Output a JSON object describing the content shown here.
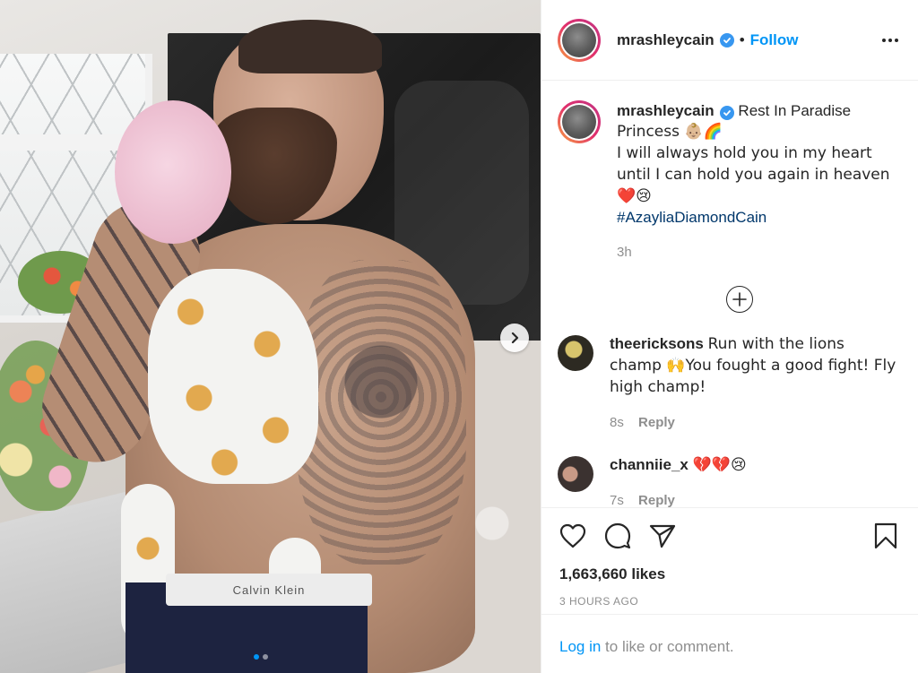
{
  "post": {
    "username": "mrashleycain",
    "follow_label": "Follow",
    "bullet": "•",
    "caption": {
      "line1": "Rest In Paradise",
      "line2": "Princess 👶🏼🌈",
      "line3": "I will always hold you in my heart until I can hold you again in heaven ❤️😢",
      "hashtag": "#AzayliaDiamondCain",
      "time": "3h"
    },
    "likes": "1,663,660 likes",
    "posted": "3 HOURS AGO",
    "photo": {
      "waistband_text": "Calvin Klein"
    }
  },
  "comments": [
    {
      "username": "theericksons",
      "text": "Run with the lions champ 🙌You fought a good fight! Fly high champ!",
      "time": "8s",
      "reply_label": "Reply"
    },
    {
      "username": "channiie_x",
      "text": "💔💔😢",
      "time": "7s",
      "reply_label": "Reply"
    }
  ],
  "login_bar": {
    "link": "Log in",
    "rest": " to like or comment."
  },
  "icons": {
    "verified": "verified-badge-icon",
    "more": "more-options-icon",
    "next": "chevron-right-icon",
    "add": "add-comment-icon",
    "like": "heart-icon",
    "comment": "comment-icon",
    "share": "send-icon",
    "save": "bookmark-icon"
  },
  "colors": {
    "accent": "#0095f6",
    "verified": "#3897f0",
    "muted": "#8e8e8e",
    "hashtag": "#00376b"
  }
}
